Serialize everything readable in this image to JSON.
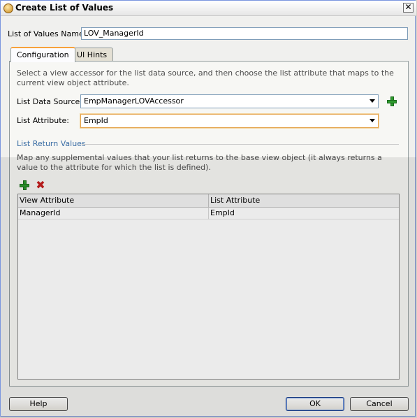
{
  "window": {
    "title": "Create List of Values",
    "close_glyph": "✕"
  },
  "lov_name": {
    "label": "List of Values Name:",
    "value": "LOV_ManagerId"
  },
  "tabs": [
    {
      "label": "Configuration",
      "active": true
    },
    {
      "label": "UI Hints",
      "active": false
    }
  ],
  "configuration": {
    "description": "Select a view accessor for the list data source, and then choose the list attribute that maps to the current view object attribute.",
    "list_data_source": {
      "label": "List Data Source:",
      "value": "EmpManagerLOVAccessor"
    },
    "list_attribute": {
      "label": "List Attribute:",
      "value": "EmpId"
    },
    "return_values": {
      "title": "List Return Values",
      "description": "Map any supplemental values that your list returns to the base view object (it always returns a value to the attribute for which the list is defined).",
      "columns": [
        "View Attribute",
        "List Attribute"
      ],
      "rows": [
        [
          "ManagerId",
          "EmpId"
        ]
      ]
    }
  },
  "buttons": {
    "help": "Help",
    "ok": "OK",
    "cancel": "Cancel"
  },
  "icons": {
    "add": "plus-icon",
    "delete": "delete-icon",
    "title": "dialog-icon"
  },
  "colors": {
    "section_title": "#3b6ea5",
    "add_icon": "#2e9a2e",
    "delete_icon": "#c41e1e",
    "active_tab_accent": "#f7a13a"
  }
}
